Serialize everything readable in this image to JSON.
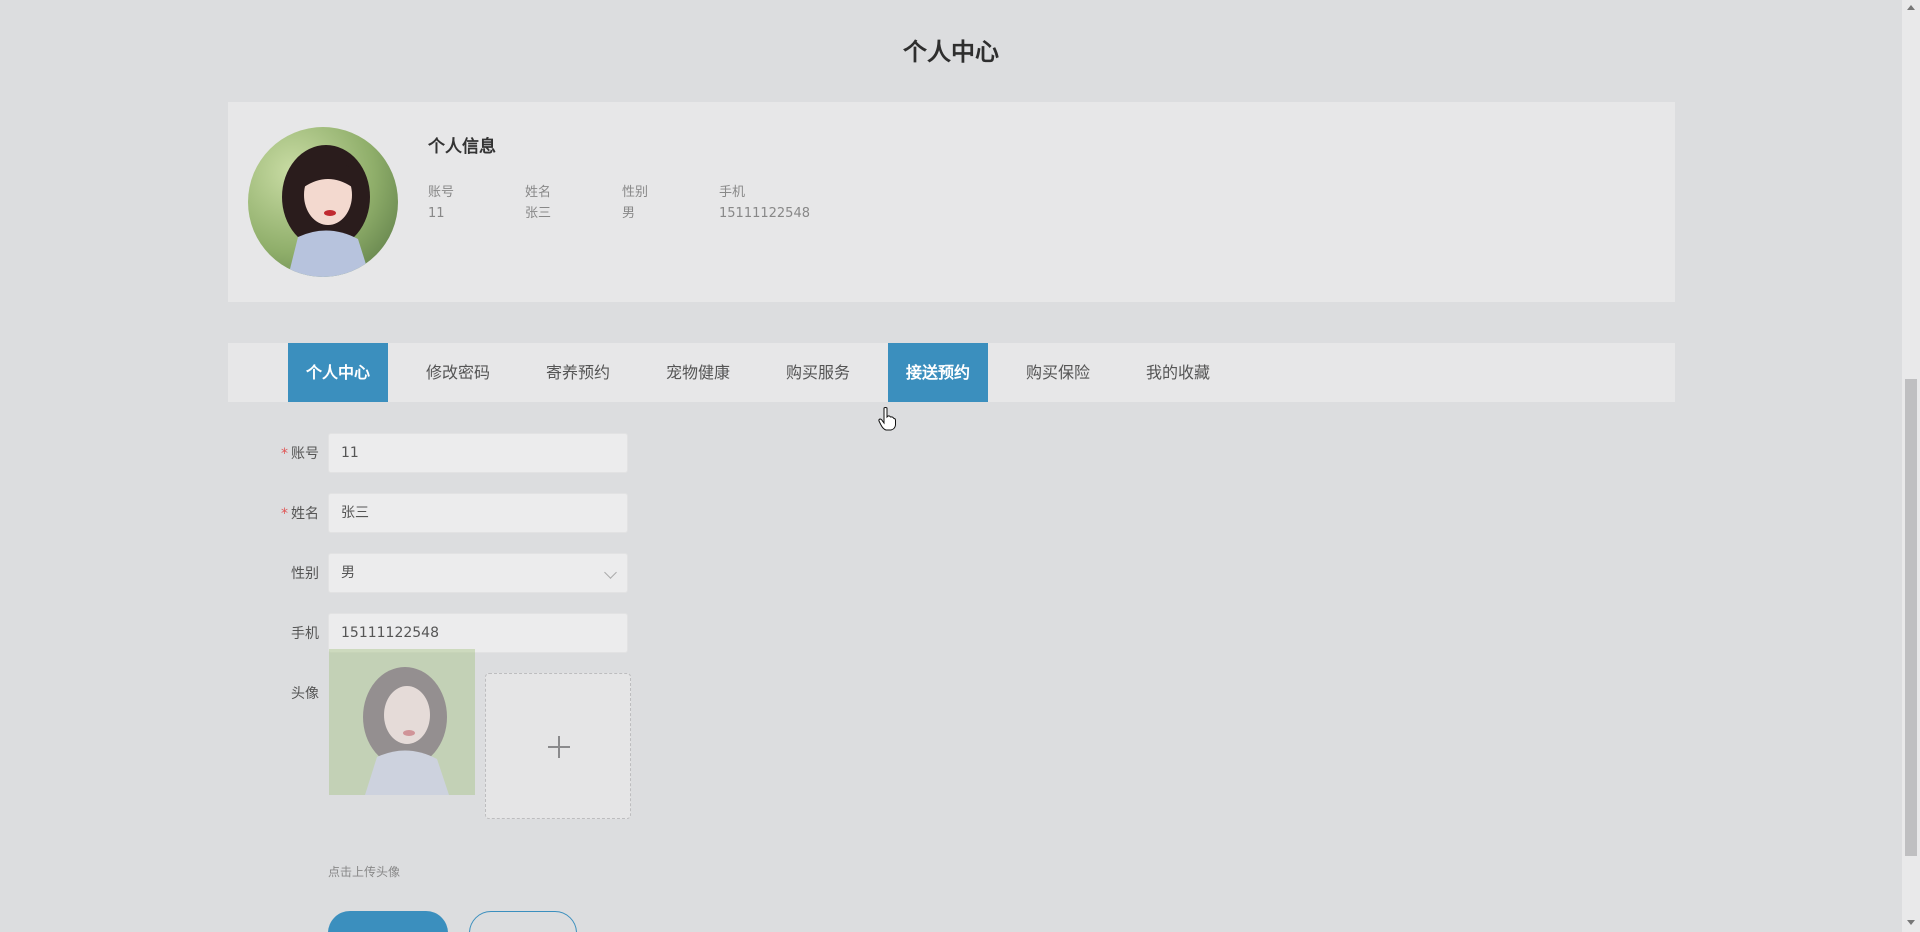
{
  "page": {
    "title": "个人中心"
  },
  "profile": {
    "section_title": "个人信息",
    "fields": [
      {
        "label": "账号",
        "value": "11"
      },
      {
        "label": "姓名",
        "value": "张三"
      },
      {
        "label": "性别",
        "value": "男"
      },
      {
        "label": "手机",
        "value": "15111122548"
      }
    ]
  },
  "tabs": [
    {
      "label": "个人中心",
      "active": true
    },
    {
      "label": "修改密码",
      "active": false
    },
    {
      "label": "寄养预约",
      "active": false
    },
    {
      "label": "宠物健康",
      "active": false
    },
    {
      "label": "购买服务",
      "active": false
    },
    {
      "label": "接送预约",
      "active": true
    },
    {
      "label": "购买保险",
      "active": false
    },
    {
      "label": "我的收藏",
      "active": false
    }
  ],
  "form": {
    "account": {
      "label": "账号",
      "required": true,
      "value": "11"
    },
    "name": {
      "label": "姓名",
      "required": true,
      "value": "张三"
    },
    "gender": {
      "label": "性别",
      "value": "男"
    },
    "phone": {
      "label": "手机",
      "value": "15111122548"
    },
    "avatar": {
      "label": "头像",
      "upload_tip": "点击上传头像"
    },
    "required_mark": "*"
  },
  "colors": {
    "accent": "#3b8fbe",
    "background": "#dcdddf",
    "card": "#e7e7e8"
  }
}
